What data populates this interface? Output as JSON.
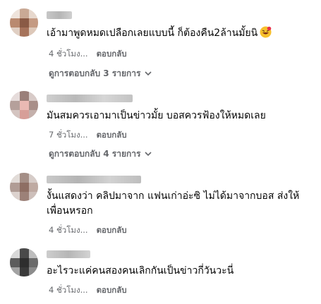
{
  "colors": {
    "text": "#050505",
    "secondary": "#65676b",
    "background": "#ffffff"
  },
  "comments": [
    {
      "text": "เอ้ามาพูดหมดเปลือกเลยแบบนี้ ก็ต้องคืน2ล้านมั้ยนิ",
      "emoji": "laughing-face-with-heart-icon",
      "time": "4 ชั่วโมง...",
      "reply": "ตอบกลับ",
      "view_replies": "ดูการตอบกลับ 3 รายการ"
    },
    {
      "text": "มันสมควรเอามาเป็นข่าวมั้ย บอสควรฟ้องให้หมดเลย",
      "time": "7 ชั่วโมง...",
      "reply": "ตอบกลับ",
      "view_replies": "ดูการตอบกลับ 4 รายการ"
    },
    {
      "text": "งั้นแสดงว่า คลิปมาจาก แฟนเก่าอ่ะซิ ไม่ได้มาจากบอส ส่งให้เพื่อนหรอก",
      "time": "4 ชั่วโมง...",
      "reply": "ตอบกลับ"
    },
    {
      "text": "อะไรวะแค่คนสองคนเลิกกันเป็นข่าวกี่วันวะนี่",
      "time": "4 ชั่วโมง...",
      "reply": "ตอบกลับ"
    }
  ]
}
